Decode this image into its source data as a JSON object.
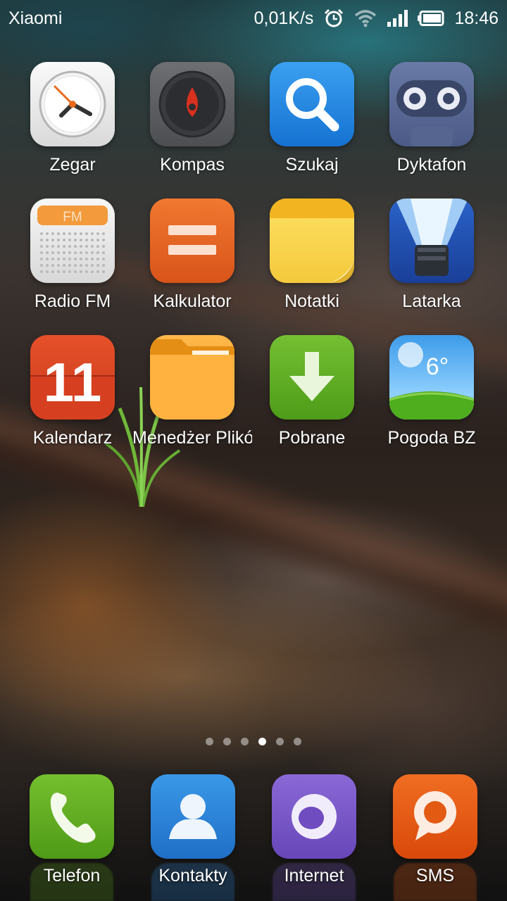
{
  "status_bar": {
    "carrier": "Xiaomi",
    "net_speed": "0,01K/s",
    "time": "18:46",
    "icons": [
      "alarm-icon",
      "wifi-icon",
      "signal-icon",
      "battery-icon"
    ]
  },
  "apps": [
    {
      "label": "Zegar",
      "icon": "clock-icon"
    },
    {
      "label": "Kompas",
      "icon": "compass-icon"
    },
    {
      "label": "Szukaj",
      "icon": "search-icon"
    },
    {
      "label": "Dyktafon",
      "icon": "recorder-icon"
    },
    {
      "label": "Radio FM",
      "icon": "radio-icon",
      "badge": "FM"
    },
    {
      "label": "Kalkulator",
      "icon": "calculator-icon"
    },
    {
      "label": "Notatki",
      "icon": "notes-icon"
    },
    {
      "label": "Latarka",
      "icon": "flashlight-icon"
    },
    {
      "label": "Kalendarz",
      "icon": "calendar-icon",
      "day": "11"
    },
    {
      "label": "Menedżer Plików",
      "icon": "folder-icon"
    },
    {
      "label": "Pobrane",
      "icon": "download-icon"
    },
    {
      "label": "Pogoda BZ",
      "icon": "weather-icon",
      "temperature": "6°"
    }
  ],
  "pages": {
    "count": 6,
    "active_index": 3
  },
  "dock": [
    {
      "label": "Telefon",
      "icon": "phone-icon"
    },
    {
      "label": "Kontakty",
      "icon": "contacts-icon"
    },
    {
      "label": "Internet",
      "icon": "browser-icon"
    },
    {
      "label": "SMS",
      "icon": "sms-icon"
    }
  ],
  "colors": {
    "phone": "#5ea21f",
    "contacts": "#2f86d6",
    "browser": "#7b59c9",
    "sms": "#e35a12"
  }
}
